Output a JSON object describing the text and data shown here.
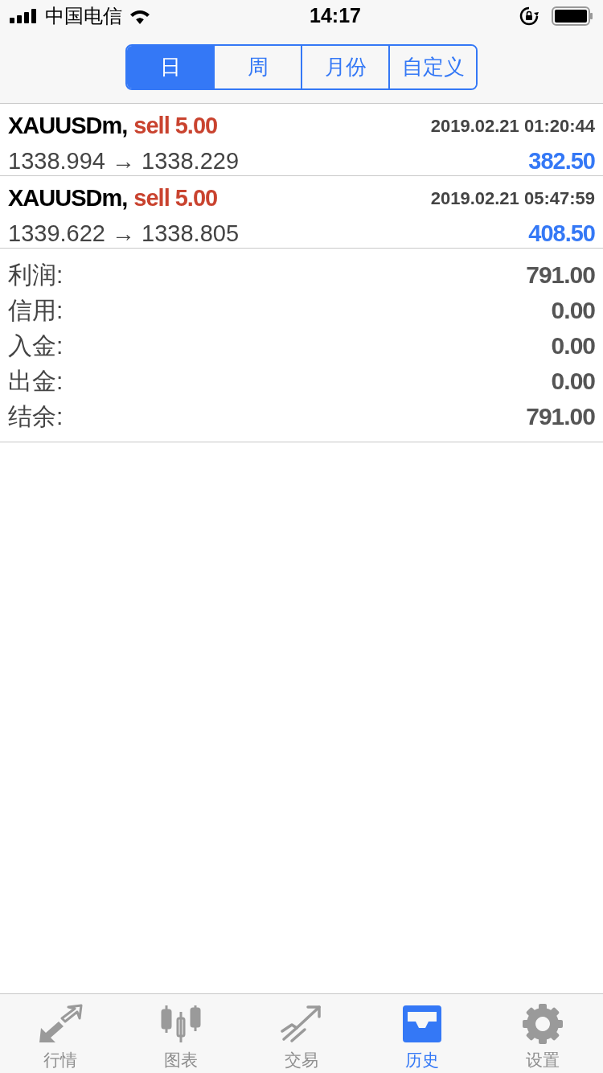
{
  "status_bar": {
    "carrier": "中国电信",
    "time": "14:17"
  },
  "period_tabs": [
    {
      "label": "日",
      "selected": true
    },
    {
      "label": "周",
      "selected": false
    },
    {
      "label": "月份",
      "selected": false
    },
    {
      "label": "自定义",
      "selected": false
    }
  ],
  "trades": [
    {
      "symbol": "XAUUSDm,",
      "action": "sell 5.00",
      "time": "2019.02.21 01:20:44",
      "prices": "1338.994 → 1338.229",
      "profit": "382.50"
    },
    {
      "symbol": "XAUUSDm,",
      "action": "sell 5.00",
      "time": "2019.02.21 05:47:59",
      "prices": "1339.622 → 1338.805",
      "profit": "408.50"
    }
  ],
  "summary": [
    {
      "label": "利润:",
      "value": "791.00"
    },
    {
      "label": "信用:",
      "value": "0.00"
    },
    {
      "label": "入金:",
      "value": "0.00"
    },
    {
      "label": "出金:",
      "value": "0.00"
    },
    {
      "label": "结余:",
      "value": "791.00"
    }
  ],
  "tab_bar": [
    {
      "label": "行情",
      "selected": false
    },
    {
      "label": "图表",
      "selected": false
    },
    {
      "label": "交易",
      "selected": false
    },
    {
      "label": "历史",
      "selected": true
    },
    {
      "label": "设置",
      "selected": false
    }
  ]
}
